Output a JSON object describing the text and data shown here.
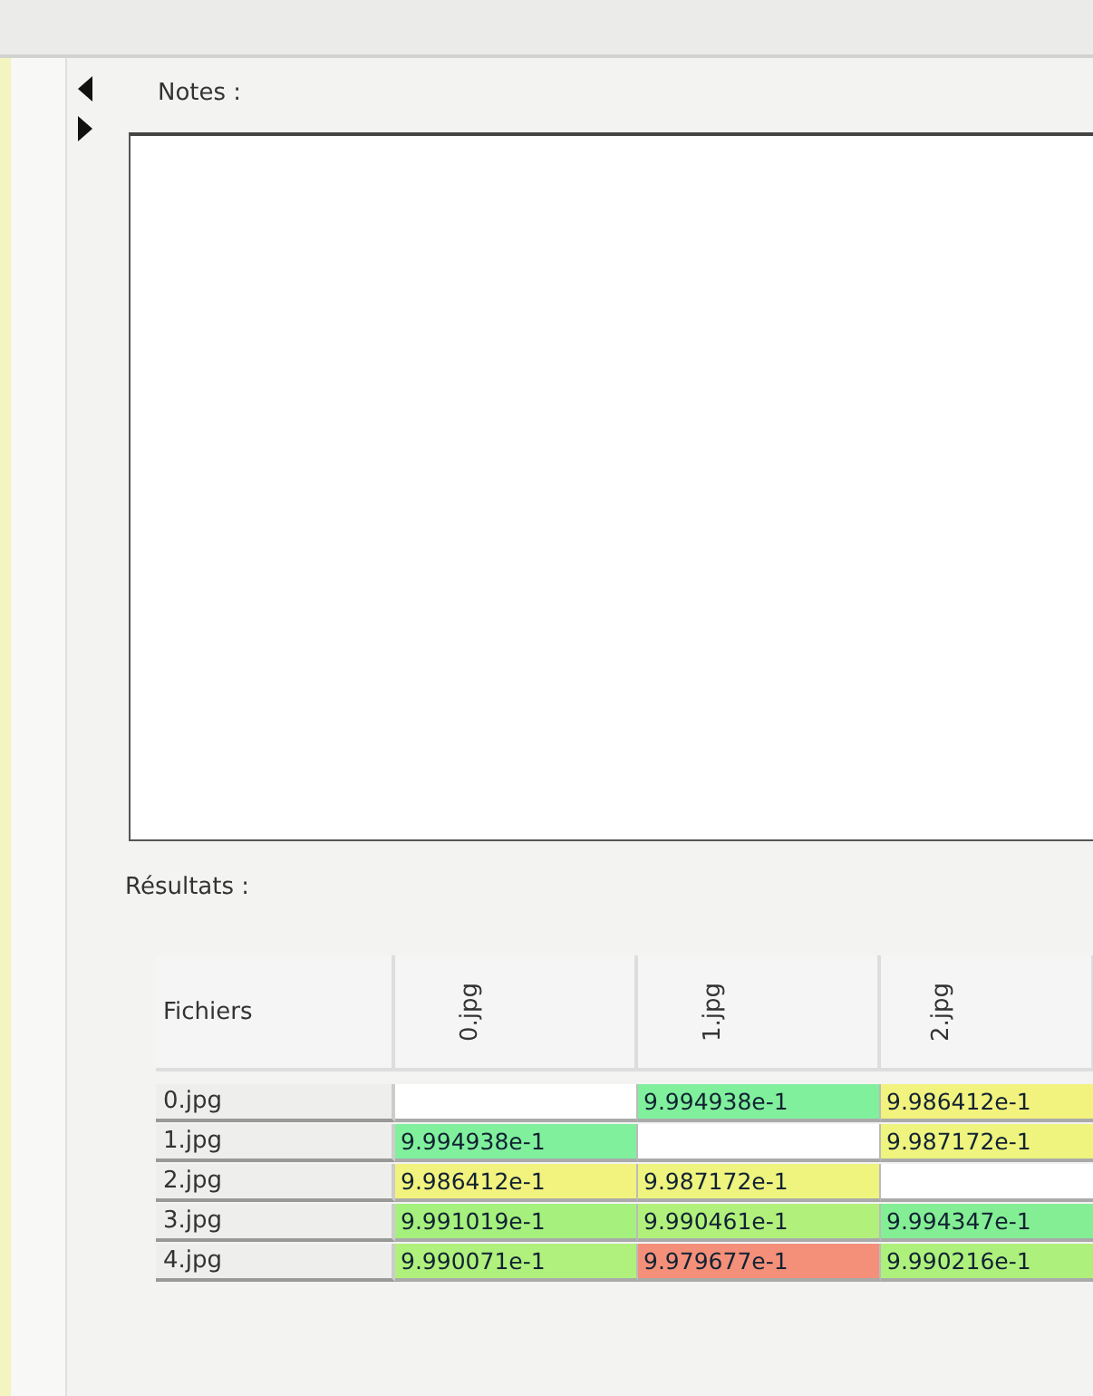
{
  "notes": {
    "label": "Notes :"
  },
  "results": {
    "label": "Résultats :",
    "corner": "Fichiers",
    "columns": [
      "0.jpg",
      "1.jpg",
      "2.jpg"
    ],
    "rows": [
      {
        "name": "0.jpg",
        "cells": [
          null,
          {
            "text": "9.994938e-1",
            "color": "#80f09c"
          },
          {
            "text": "9.986412e-1",
            "color": "#f2f27e"
          }
        ]
      },
      {
        "name": "1.jpg",
        "cells": [
          {
            "text": "9.994938e-1",
            "color": "#80f09c"
          },
          null,
          {
            "text": "9.987172e-1",
            "color": "#eef47e"
          }
        ]
      },
      {
        "name": "2.jpg",
        "cells": [
          {
            "text": "9.986412e-1",
            "color": "#f2f27e"
          },
          {
            "text": "9.987172e-1",
            "color": "#eef47e"
          },
          null
        ]
      },
      {
        "name": "3.jpg",
        "cells": [
          {
            "text": "9.991019e-1",
            "color": "#a6f07e"
          },
          {
            "text": "9.990461e-1",
            "color": "#b2f07c"
          },
          {
            "text": "9.994347e-1",
            "color": "#84ee94"
          }
        ]
      },
      {
        "name": "4.jpg",
        "cells": [
          {
            "text": "9.990071e-1",
            "color": "#b0f07c"
          },
          {
            "text": "9.979677e-1",
            "color": "#f4907a"
          },
          {
            "text": "9.990216e-1",
            "color": "#aef07c"
          }
        ]
      }
    ]
  }
}
